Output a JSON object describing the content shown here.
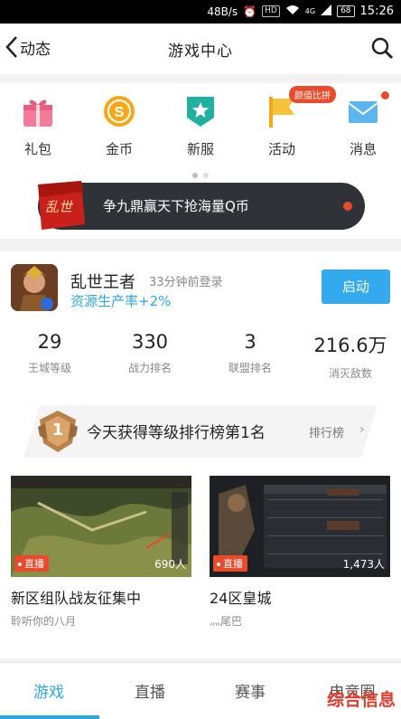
{
  "status_bar": {
    "speed": "48B/s",
    "hd": "HD",
    "net": "4G",
    "battery": "68",
    "time": "15:26"
  },
  "nav": {
    "back_label": "动态",
    "title": "游戏中心"
  },
  "quick_menu": {
    "items": [
      {
        "label": "礼包",
        "icon": "gift-icon"
      },
      {
        "label": "金币",
        "icon": "coin-icon"
      },
      {
        "label": "新服",
        "icon": "new-server-icon"
      },
      {
        "label": "活动",
        "icon": "flag-icon",
        "badge": "颜值比拼"
      },
      {
        "label": "消息",
        "icon": "envelope-icon"
      }
    ],
    "page_dots": 2,
    "active_dot": 0
  },
  "promo": {
    "logo_text": "乱世",
    "text": "争九鼎赢天下抢海量Q币"
  },
  "game": {
    "name": "乱世王者",
    "last_login": "33分钟前登录",
    "production": "资源生产率+2%",
    "launch_label": "启动",
    "stats": [
      {
        "value": "29",
        "label": "王城等级"
      },
      {
        "value": "330",
        "label": "战力排名"
      },
      {
        "value": "3",
        "label": "联盟排名"
      },
      {
        "value": "216.6万",
        "label": "消灭敌数"
      }
    ]
  },
  "ranking": {
    "badge_text": "1",
    "text": "今天获得等级排行榜第1名",
    "link": "排行榜"
  },
  "live_streams": [
    {
      "title": "新区组队战友征集中",
      "author": "聆听你的八月",
      "live_label": "直播",
      "viewers": "690人"
    },
    {
      "title": "24区皇城",
      "author": "灬尾巴",
      "live_label": "直播",
      "viewers": "1,473人"
    }
  ],
  "tabs": [
    {
      "label": "游戏",
      "active": true
    },
    {
      "label": "直播",
      "active": false
    },
    {
      "label": "赛事",
      "active": false
    },
    {
      "label": "电竞圈",
      "active": false
    }
  ],
  "watermark": "综合信息",
  "colors": {
    "accent": "#2aa6e0",
    "live_red": "#e84a2a",
    "button": "#33aaee"
  }
}
